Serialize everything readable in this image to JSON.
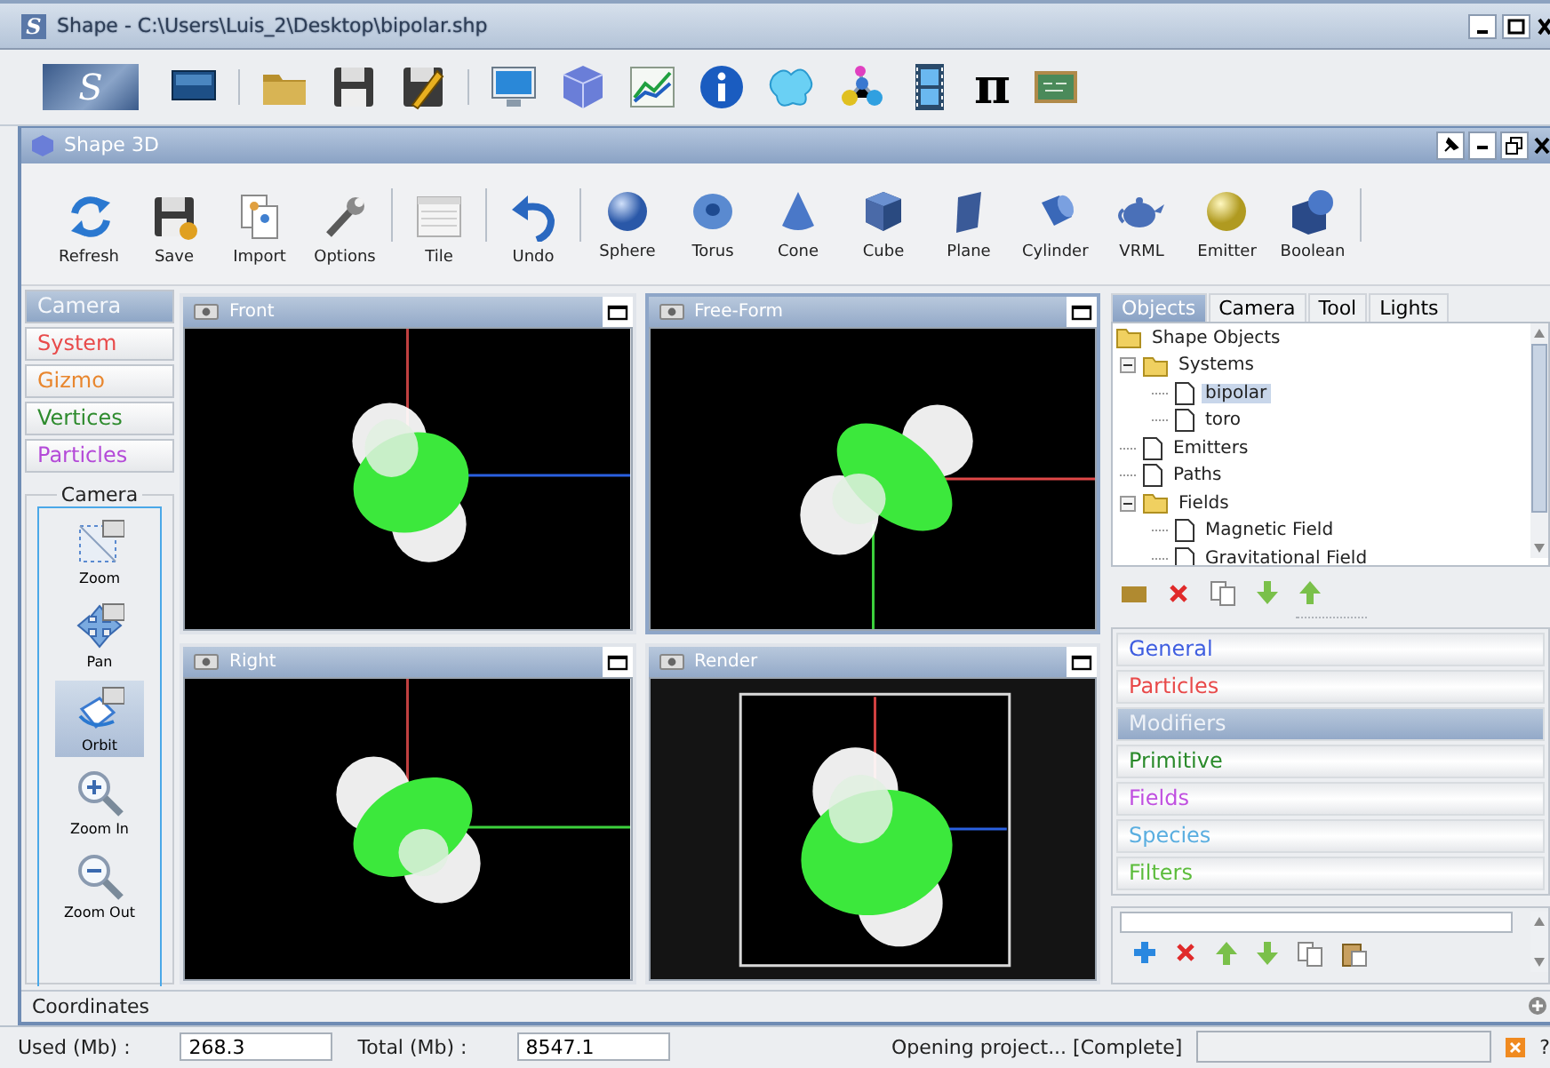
{
  "window": {
    "app_letter": "S",
    "title": "Shape - C:\\Users\\Luis_2\\Desktop\\bipolar.shp"
  },
  "main_toolbar": {
    "logo_letter": "S",
    "pi_label": "π"
  },
  "document": {
    "title": "Shape 3D"
  },
  "toolbar": [
    {
      "label": "Refresh"
    },
    {
      "label": "Save"
    },
    {
      "label": "Import"
    },
    {
      "label": "Options"
    },
    {
      "label": "Tile"
    },
    {
      "label": "Undo"
    },
    {
      "label": "Sphere"
    },
    {
      "label": "Torus"
    },
    {
      "label": "Cone"
    },
    {
      "label": "Cube"
    },
    {
      "label": "Plane"
    },
    {
      "label": "Cylinder"
    },
    {
      "label": "VRML"
    },
    {
      "label": "Emitter"
    },
    {
      "label": "Boolean"
    }
  ],
  "categories": [
    {
      "label": "Camera",
      "selected": true
    },
    {
      "label": "System",
      "selected": false,
      "color": "#e84a4a"
    },
    {
      "label": "Gizmo",
      "selected": false,
      "color": "#e8862e"
    },
    {
      "label": "Vertices",
      "selected": false,
      "color": "#2e8b2e"
    },
    {
      "label": "Particles",
      "selected": false,
      "color": "#b44ad8"
    }
  ],
  "camera_tools": {
    "title": "Camera",
    "items": [
      {
        "label": "Zoom",
        "selected": false
      },
      {
        "label": "Pan",
        "selected": false
      },
      {
        "label": "Orbit",
        "selected": true
      },
      {
        "label": "Zoom In",
        "selected": false
      },
      {
        "label": "Zoom Out",
        "selected": false
      }
    ]
  },
  "viewports": [
    {
      "title": "Front",
      "selected": false,
      "kind": "front"
    },
    {
      "title": "Free-Form",
      "selected": true,
      "kind": "free"
    },
    {
      "title": "Right",
      "selected": false,
      "kind": "right"
    },
    {
      "title": "Render",
      "selected": false,
      "kind": "render"
    }
  ],
  "object_tabs": [
    {
      "label": "Objects",
      "selected": true
    },
    {
      "label": "Camera",
      "selected": false
    },
    {
      "label": "Tool",
      "selected": false
    },
    {
      "label": "Lights",
      "selected": false
    }
  ],
  "tree": [
    {
      "label": "Shape Objects",
      "kind": "folder",
      "selected": false,
      "children": [
        {
          "label": "Systems",
          "kind": "folder",
          "expanded": true,
          "selected": false,
          "children": [
            {
              "label": "bipolar",
              "kind": "file",
              "selected": true
            },
            {
              "label": "toro",
              "kind": "file",
              "selected": false
            }
          ]
        },
        {
          "label": "Emitters",
          "kind": "file",
          "selected": false
        },
        {
          "label": "Paths",
          "kind": "file",
          "selected": false
        },
        {
          "label": "Fields",
          "kind": "folder",
          "expanded": true,
          "selected": false,
          "children": [
            {
              "label": "Magnetic Field",
              "kind": "file",
              "selected": false
            },
            {
              "label": "Gravitational Field",
              "kind": "file",
              "selected": false
            }
          ]
        }
      ]
    }
  ],
  "properties": [
    {
      "label": "General",
      "selected": false,
      "color": "#3f5ee0"
    },
    {
      "label": "Particles",
      "selected": false,
      "color": "#e84a4a"
    },
    {
      "label": "Modifiers",
      "selected": true
    },
    {
      "label": "Primitive",
      "selected": false,
      "color": "#2a8a2a"
    },
    {
      "label": "Fields",
      "selected": false,
      "color": "#c050e0"
    },
    {
      "label": "Species",
      "selected": false,
      "color": "#5aaee0"
    },
    {
      "label": "Filters",
      "selected": false,
      "color": "#5cbc3c"
    }
  ],
  "coordinates": {
    "title": "Coordinates"
  },
  "status_bar": {
    "used_label": "Used (Mb) :",
    "used_value": "268.3",
    "total_label": "Total (Mb) :",
    "total_value": "8547.1",
    "message": "Opening project... [Complete]",
    "progress": {
      "level": 0
    },
    "help": "?"
  }
}
